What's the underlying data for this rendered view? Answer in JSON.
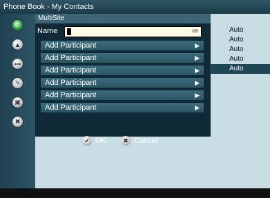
{
  "title": "Phone Book - My Contacts",
  "dialog": {
    "title": "MultiSite",
    "name_label": "Name",
    "name_value": "",
    "participants": [
      {
        "label": "Add Participant"
      },
      {
        "label": "Add Participant"
      },
      {
        "label": "Add Participant"
      },
      {
        "label": "Add Participant"
      },
      {
        "label": "Add Participant"
      },
      {
        "label": "Add Participant"
      }
    ],
    "ok_label": "OK",
    "cancel_label": "Cancel"
  },
  "auto_options": [
    "Auto",
    "Auto",
    "Auto",
    "Auto",
    "Auto"
  ],
  "auto_selected_index": 4,
  "colors": {
    "accent": "#1d4554",
    "dialog_bg": "#0f2a36",
    "content_bg": "#c8dce4"
  },
  "sidebar_icons": [
    "phone-icon",
    "menu-up-icon",
    "contacts-icon",
    "edit-icon",
    "tv-icon",
    "tools-icon"
  ]
}
